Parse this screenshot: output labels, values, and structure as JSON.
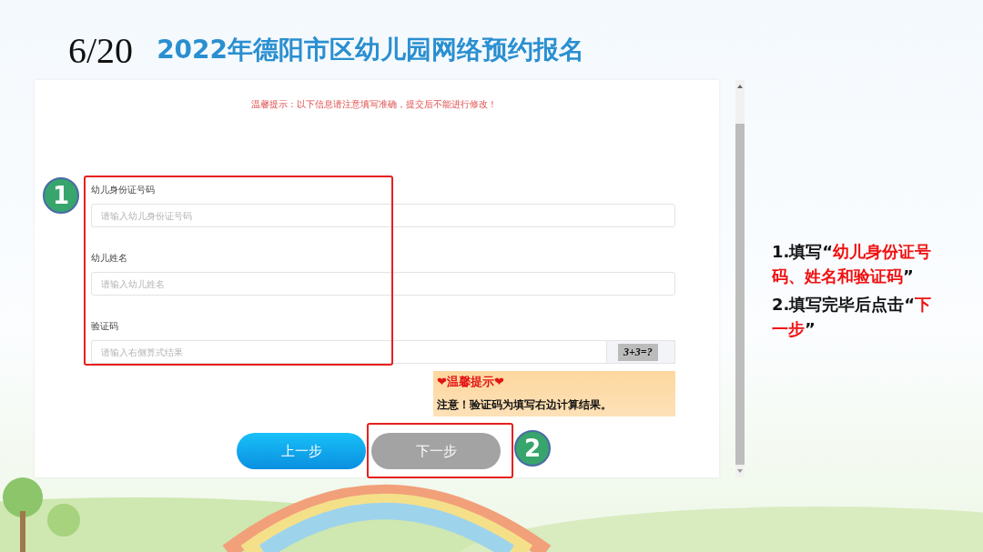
{
  "slide": {
    "page": "6/20",
    "title": "2022年德阳市区幼儿园网络预约报名"
  },
  "form": {
    "notice": "温馨提示：以下信息请注意填写准确，提交后不能进行修改！",
    "fields": [
      {
        "kind": "text",
        "label": "幼儿身份证号码",
        "placeholder": "请输入幼儿身份证号码"
      },
      {
        "kind": "text",
        "label": "幼儿姓名",
        "placeholder": "请输入幼儿姓名"
      },
      {
        "kind": "captcha",
        "label": "验证码",
        "placeholder": "请输入右侧算式结果",
        "captcha": "3+3=?"
      }
    ],
    "tip": {
      "heading": "❤温馨提示❤",
      "text": "注意！验证码为填写右边计算结果。"
    },
    "buttons": [
      {
        "kind": "primary",
        "label": "上一步"
      },
      {
        "kind": "secondary",
        "label": "下一步"
      }
    ]
  },
  "callouts": [
    "1",
    "2"
  ],
  "instructions": [
    "1.填写“**幼儿身份证号码、姓名和验证码**”",
    "2.填写完毕后点击“**下一步**”"
  ]
}
